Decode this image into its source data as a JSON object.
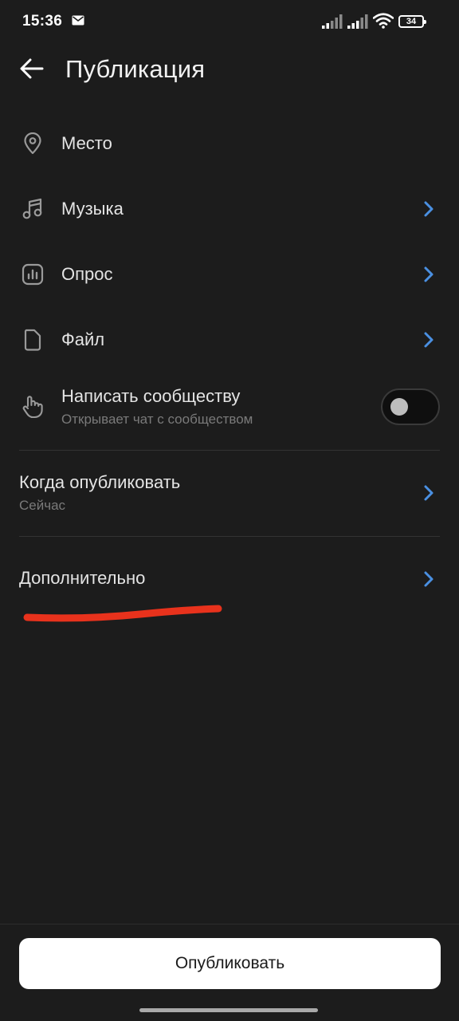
{
  "status_bar": {
    "time": "15:36",
    "battery": "34",
    "icons": [
      "mail-icon",
      "signal-icon",
      "signal-icon",
      "wifi-icon",
      "battery-icon"
    ]
  },
  "header": {
    "title": "Публикация",
    "back_icon": "arrow-left-icon"
  },
  "options": [
    {
      "label": "Место",
      "icon": "location-pin-icon",
      "has_chevron": false
    },
    {
      "label": "Музыка",
      "icon": "music-note-icon",
      "has_chevron": true
    },
    {
      "label": "Опрос",
      "icon": "poll-icon",
      "has_chevron": true
    },
    {
      "label": "Файл",
      "icon": "file-icon",
      "has_chevron": true
    },
    {
      "label": "Написать сообществу",
      "sublabel": "Открывает чат с сообществом",
      "icon": "hand-pointer-icon",
      "toggle": false
    }
  ],
  "schedule": {
    "label": "Когда опубликовать",
    "value": "Сейчас"
  },
  "advanced": {
    "label": "Дополнительно"
  },
  "publish_button": {
    "label": "Опубликовать"
  },
  "colors": {
    "background": "#1c1c1c",
    "accent": "#4a90e2",
    "annotation": "#e8321c",
    "button_bg": "#ffffff"
  }
}
